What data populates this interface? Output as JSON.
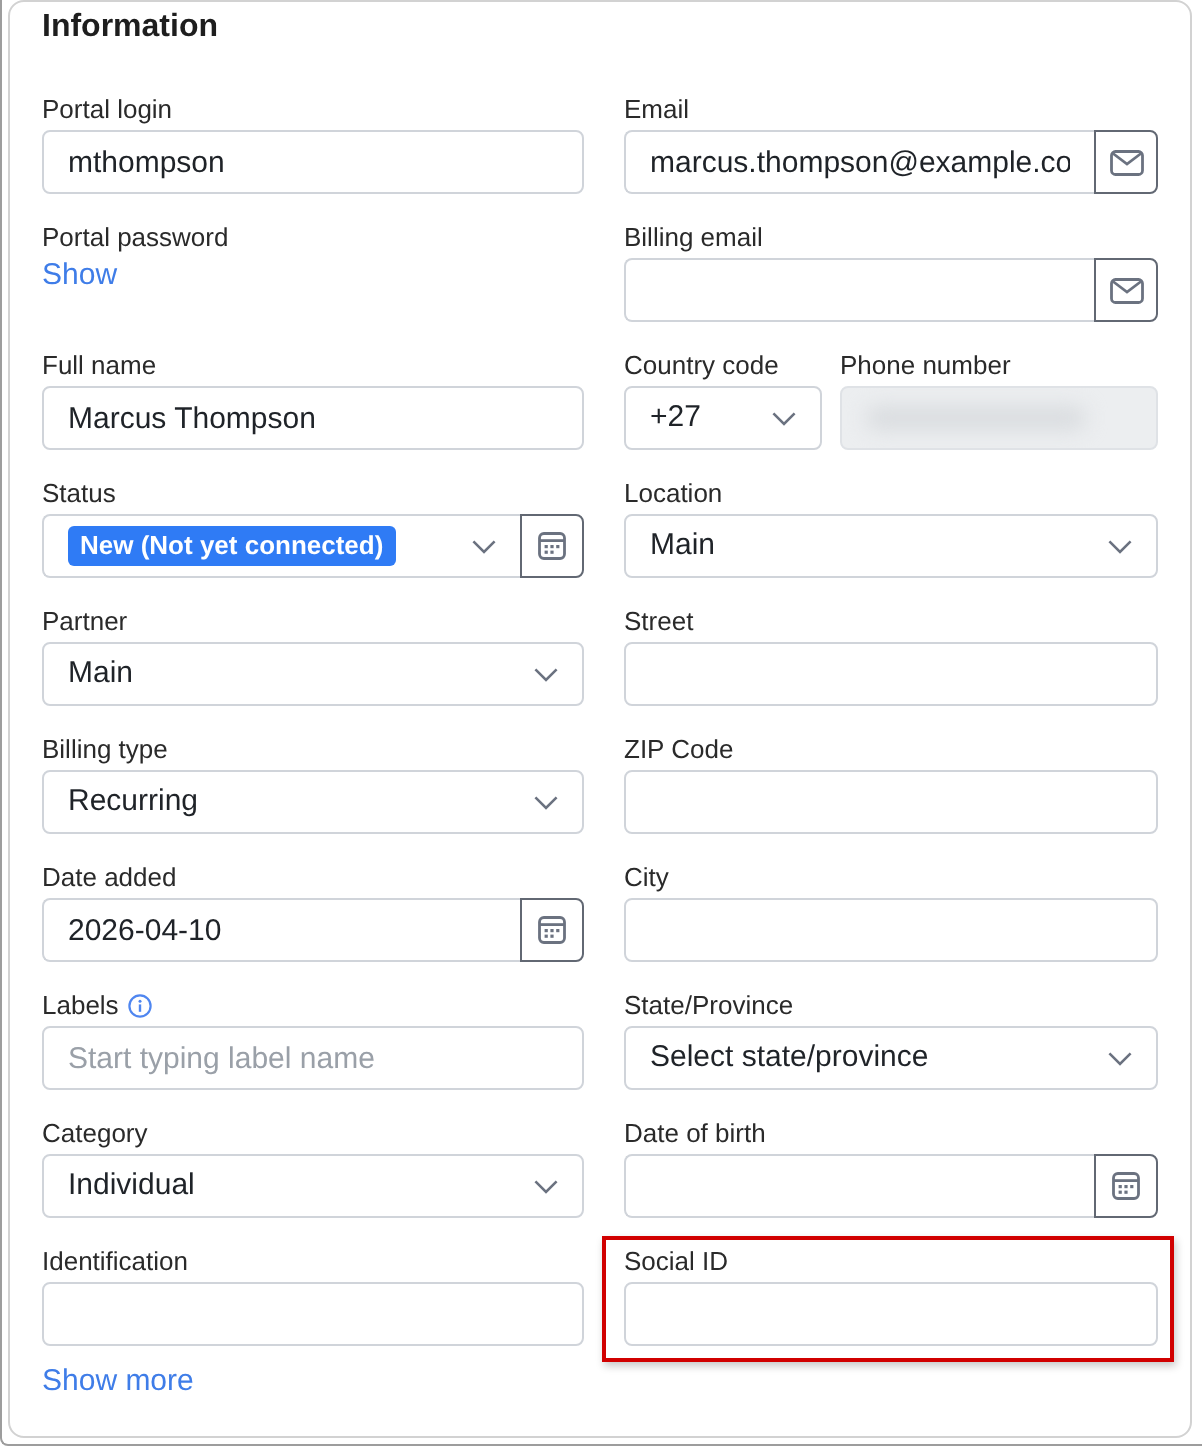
{
  "title": "Information",
  "fields": [
    {
      "kind": "input",
      "label": "Portal login",
      "value": "mthompson",
      "highlighted": false
    },
    {
      "kind": "email",
      "label": "Email",
      "value": "marcus.thompson@example.co",
      "highlighted": false
    },
    {
      "kind": "secret",
      "label": "Portal password",
      "link": "Show",
      "highlighted": false
    },
    {
      "kind": "email",
      "label": "Billing email",
      "highlighted": false
    },
    {
      "kind": "input",
      "label": "Full name",
      "value": "Marcus Thompson",
      "highlighted": false
    },
    {
      "kind": "pair",
      "parts": [
        {
          "kind": "select",
          "label": "Country code",
          "value": "+27"
        },
        {
          "kind": "input",
          "label": "Phone number",
          "blurred": true
        }
      ],
      "highlighted": false
    },
    {
      "kind": "status",
      "label": "Status",
      "badge": "New (Not yet connected)",
      "highlighted": false
    },
    {
      "kind": "select",
      "label": "Location",
      "value": "Main",
      "highlighted": false
    },
    {
      "kind": "select",
      "label": "Partner",
      "value": "Main",
      "highlighted": false
    },
    {
      "kind": "input",
      "label": "Street",
      "highlighted": false
    },
    {
      "kind": "select",
      "label": "Billing type",
      "value": "Recurring",
      "highlighted": false
    },
    {
      "kind": "input",
      "label": "ZIP Code",
      "highlighted": false
    },
    {
      "kind": "date",
      "label": "Date added",
      "value": "2026-04-10",
      "highlighted": false
    },
    {
      "kind": "input",
      "label": "City",
      "highlighted": false
    },
    {
      "kind": "input",
      "label": "Labels",
      "info": true,
      "placeholder": "Start typing label name",
      "highlighted": false
    },
    {
      "kind": "select",
      "label": "State/Province",
      "value": "Select state/province",
      "highlighted": false
    },
    {
      "kind": "select",
      "label": "Category",
      "value": "Individual",
      "highlighted": false
    },
    {
      "kind": "date",
      "label": "Date of birth",
      "highlighted": false
    },
    {
      "kind": "input",
      "label": "Identification",
      "highlighted": false
    },
    {
      "kind": "input",
      "label": "Social ID",
      "highlighted": true
    }
  ],
  "show_more": "Show more"
}
